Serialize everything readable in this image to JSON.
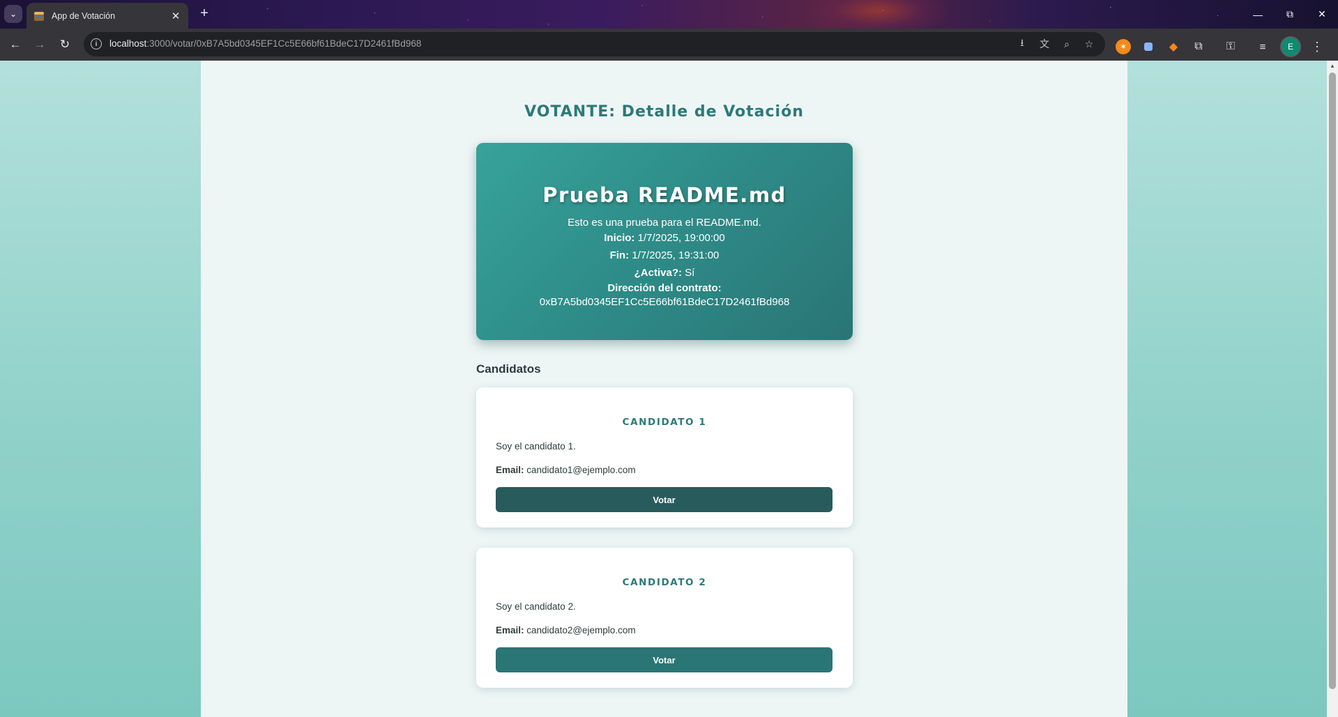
{
  "browser": {
    "tab_title": "App de Votación",
    "url_host": "localhost",
    "url_rest": ":3000/votar/0xB7A5bd0345EF1Cc5E66bf61BdeC17D2461fBd968",
    "profile_initial": "E",
    "icons": [
      "tab-search-icon",
      "close-icon",
      "plus-icon",
      "back-icon",
      "forward-icon",
      "reload-icon",
      "site-info-icon",
      "install-icon",
      "translate-icon",
      "zoom-icon",
      "star-icon",
      "extension-icon",
      "puzzle-icon",
      "key-icon",
      "media-icon",
      "menu-icon",
      "minimize-icon",
      "restore-icon",
      "close-window-icon"
    ]
  },
  "page": {
    "title": "VOTANTE: Detalle de Votación",
    "election": {
      "name": "Prueba README.md",
      "description": "Esto es una prueba para el README.md.",
      "start_label": "Inicio:",
      "start_value": "1/7/2025, 19:00:00",
      "end_label": "Fin:",
      "end_value": "1/7/2025, 19:31:00",
      "active_label": "¿Activa?:",
      "active_value": "Sí",
      "address_label": "Dirección del contrato:",
      "address_value": "0xB7A5bd0345EF1Cc5E66bf61BdeC17D2461fBd968"
    },
    "candidates_title": "Candidatos",
    "candidates": [
      {
        "name": "CANDIDATO 1",
        "description": "Soy el candidato 1.",
        "email_label": "Email:",
        "email": "candidato1@ejemplo.com",
        "vote_label": "Votar"
      },
      {
        "name": "CANDIDATO 2",
        "description": "Soy el candidato 2.",
        "email_label": "Email:",
        "email": "candidato2@ejemplo.com",
        "vote_label": "Votar"
      }
    ]
  },
  "colors": {
    "accent": "#2b7a78",
    "card_gradient_start": "#37a39a",
    "card_gradient_end": "#2a7575",
    "vote_button_1": "#285b5b",
    "vote_button_2": "#2a7575"
  }
}
